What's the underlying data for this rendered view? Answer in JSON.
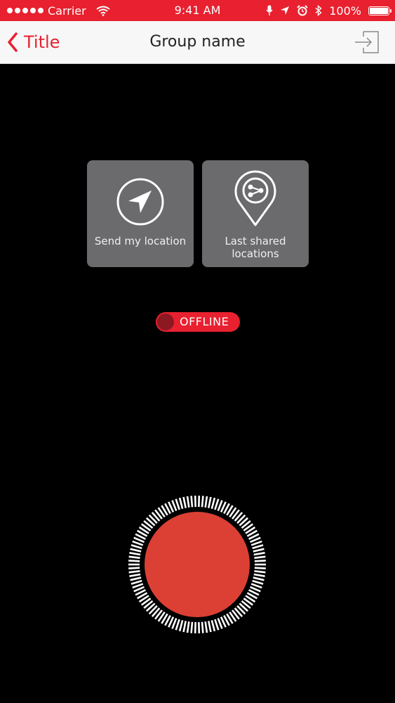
{
  "status_bar": {
    "carrier": "Carrier",
    "time": "9:41 AM",
    "battery": "100%",
    "background_color": "#e8202f",
    "icons": [
      "signal-dots-icon",
      "wifi-icon",
      "microphone-icon",
      "location-arrow-icon",
      "alarm-icon",
      "bluetooth-icon",
      "battery-icon"
    ]
  },
  "nav_bar": {
    "back_label": "Title",
    "title": "Group name",
    "back_icon": "chevron-left-icon",
    "exit_icon": "exit-icon",
    "accent_color": "#e8202f"
  },
  "actions": [
    {
      "label": "Send my location",
      "icon": "navigation-arrow-icon"
    },
    {
      "label": "Last shared locations",
      "icon": "location-share-pin-icon"
    }
  ],
  "toggle": {
    "label": "OFFLINE",
    "state": "offline",
    "color": "#e8202f"
  },
  "record_button": {
    "icon": "record-icon",
    "color": "#dc4034"
  }
}
